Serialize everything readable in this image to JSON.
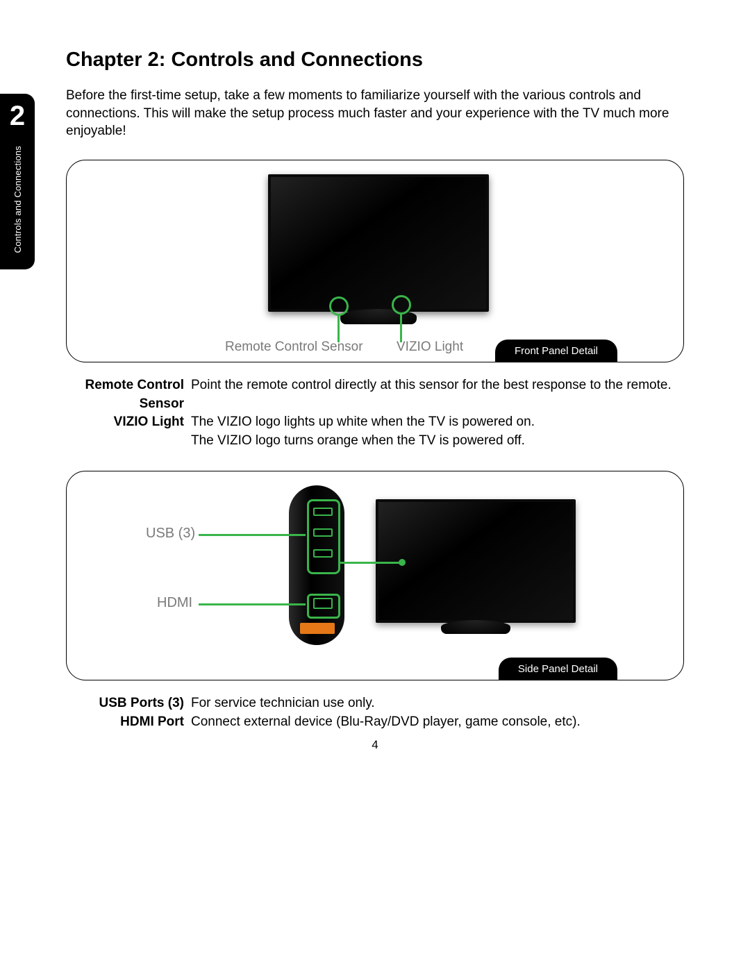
{
  "side_tab": {
    "number": "2",
    "label": "Controls and Connections"
  },
  "chapter_title": "Chapter 2: Controls and Connections",
  "intro_text": "Before the first-time setup, take a few moments to familiarize yourself with the various controls and connections. This will make the setup process much faster and your experience with the TV much more enjoyable!",
  "front_panel": {
    "tag": "Front Panel Detail",
    "label_remote": "Remote Control Sensor",
    "label_vizio": "VIZIO Light"
  },
  "front_defs": [
    {
      "term": "Remote Control Sensor",
      "desc": "Point the remote control directly at this sensor for the best response to the remote."
    },
    {
      "term": "VIZIO Light",
      "desc": "The VIZIO logo lights up white when the TV is powered on."
    },
    {
      "term": "",
      "desc": "The VIZIO logo turns orange when the TV is powered off."
    }
  ],
  "side_panel": {
    "tag": "Side Panel Detail",
    "label_usb": "USB (3)",
    "label_hdmi": "HDMI"
  },
  "side_defs": [
    {
      "term": "USB Ports (3)",
      "desc": "For service technician use only."
    },
    {
      "term": "HDMI Port",
      "desc": "Connect external device (Blu-Ray/DVD player, game console, etc)."
    }
  ],
  "page_number": "4"
}
